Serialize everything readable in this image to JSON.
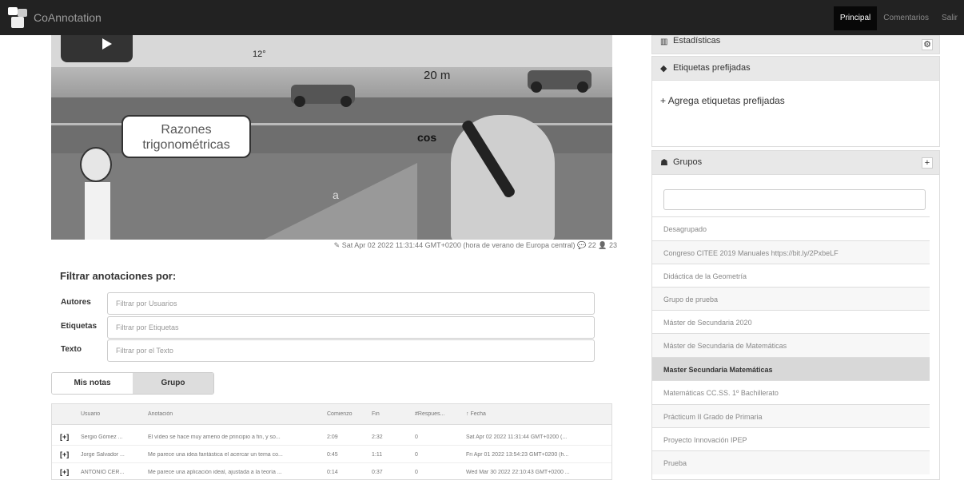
{
  "navbar": {
    "brand": "CoAnnotation",
    "links": [
      {
        "label": "Principal",
        "active": true
      },
      {
        "label": "Comentarios",
        "active": false
      },
      {
        "label": "Salir",
        "active": false
      }
    ]
  },
  "video": {
    "bubble_line1": "Razones",
    "bubble_line2": "trigonométricas",
    "label_distance": "20 m",
    "label_angle": "12°",
    "label_cos": "cos",
    "label_a": "a"
  },
  "video_meta": {
    "date": "Sat Apr 02 2022 11:31:44 GMT+0200 (hora de verano de Europa central)",
    "comments": "22",
    "users": "23"
  },
  "filter": {
    "title": "Filtrar anotaciones por:",
    "rows": [
      {
        "label": "Autores",
        "placeholder": "Filtrar por Usuarios"
      },
      {
        "label": "Etiquetas",
        "placeholder": "Filtrar por Etiquetas"
      },
      {
        "label": "Texto",
        "placeholder": "Filtrar por el Texto"
      }
    ]
  },
  "tabs": {
    "mine": "Mis notas",
    "group": "Grupo"
  },
  "table": {
    "headers": [
      "Usuario",
      "Anotación",
      "Comienzo",
      "Fin",
      "#Respues...",
      "↑ Fecha"
    ],
    "rows": [
      {
        "expand": "[+]",
        "user": "Sergio Gómez ...",
        "text": "El vídeo se hace muy ameno de principio a fin, y so...",
        "start": "2:09",
        "end": "2:32",
        "replies": "0",
        "date": "Sat Apr 02 2022 11:31:44 GMT+0200 (..."
      },
      {
        "expand": "[+]",
        "user": "Jorge Salvador ...",
        "text": "Me parece una idea fantástica el acercar un tema co...",
        "start": "0:45",
        "end": "1:11",
        "replies": "0",
        "date": "Fri Apr 01 2022 13:54:23 GMT+0200 (h..."
      },
      {
        "expand": "[+]",
        "user": "ANTONIO CER...",
        "text": "Me parece una aplicación ideal, ajustada a la teoría ...",
        "start": "0:14",
        "end": "0:37",
        "replies": "0",
        "date": "Wed Mar 30 2022 22:10:43 GMT+0200 ..."
      }
    ]
  },
  "stats_panel": {
    "title": "Estadísticas",
    "btn": "⚙"
  },
  "tags_panel": {
    "title": "Etiquetas prefijadas",
    "add_label": "Agrega etiquetas prefijadas"
  },
  "groups_panel": {
    "title": "Grupos",
    "btn": "+",
    "items": [
      "Desagrupado",
      "Congreso CITEE 2019 Manuales https://bit.ly/2PxbeLF",
      "Didáctica de la Geometría",
      "Grupo de prueba",
      "Máster de Secundaria 2020",
      "Máster de Secundaria de Matemáticas",
      "Master Secundaria Matemáticas",
      "Matemáticas CC.SS. 1º Bachillerato",
      "Prácticum II Grado de Primaria",
      "Proyecto Innovación IPEP",
      "Prueba"
    ],
    "selected_index": 6
  }
}
